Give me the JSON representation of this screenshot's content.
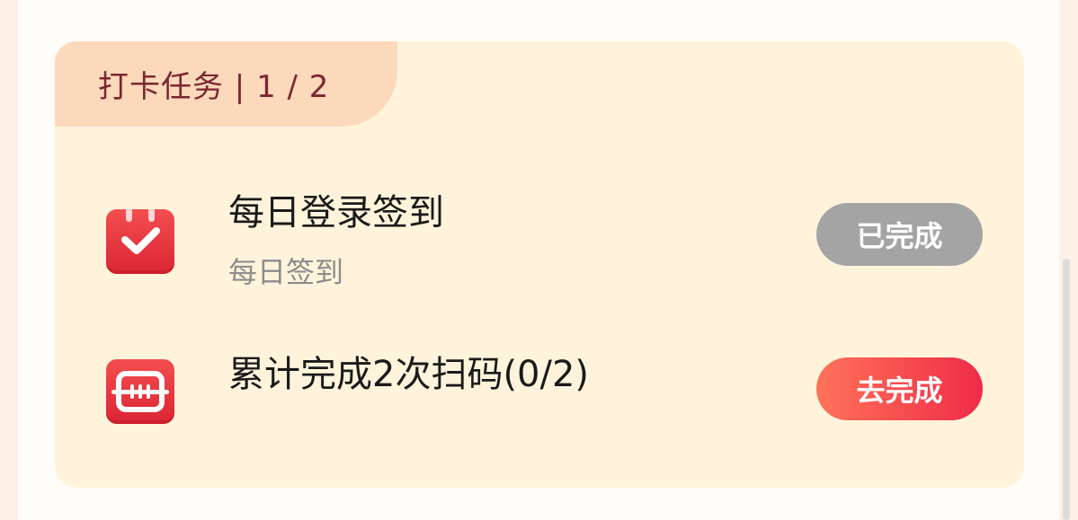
{
  "header": {
    "title": "打卡任务 | 1 / 2"
  },
  "tasks": [
    {
      "title": "每日登录签到",
      "subtitle": "每日签到",
      "icon": "calendar-check-icon",
      "status": "done",
      "button_label": "已完成"
    },
    {
      "title": "累计完成2次扫码(0/2)",
      "subtitle": "",
      "icon": "scan-icon",
      "status": "pending",
      "button_label": "去完成"
    }
  ],
  "colors": {
    "card_background": "#fff4db",
    "header_tab": "#fdd9bc",
    "header_text": "#7b2730",
    "icon_red": "#e8303c",
    "done_button": "#a4a4a4",
    "go_button": "#ef2b48"
  }
}
